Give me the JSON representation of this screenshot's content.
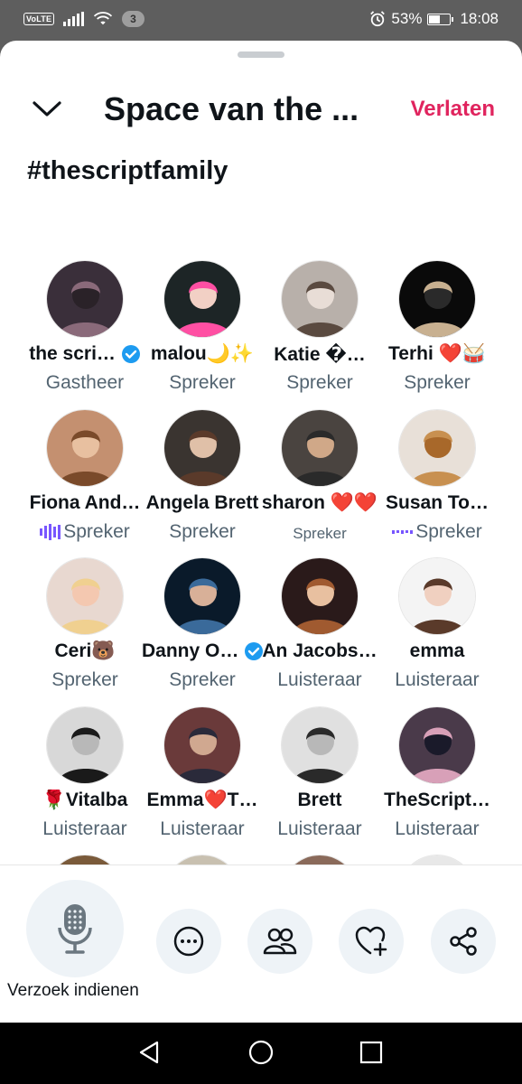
{
  "status_bar": {
    "volte": "VoLTE",
    "notification_count": "3",
    "battery_percent": "53%",
    "battery_level": 0.53,
    "time": "18:08"
  },
  "header": {
    "title": "Space van the ...",
    "leave_label": "Verlaten"
  },
  "topic": "#thescriptfamily",
  "participants": [
    {
      "name": "the scri…",
      "role": "Gastheer",
      "verified": true
    },
    {
      "name": "malou🌙✨",
      "role": "Spreker"
    },
    {
      "name": "Katie �…",
      "role": "Spreker"
    },
    {
      "name": "Terhi ❤️🥁",
      "role": "Spreker"
    },
    {
      "name": "Fiona And…",
      "role": "Spreker",
      "speaking": true
    },
    {
      "name": "Angela Brett",
      "role": "Spreker"
    },
    {
      "name": "sharon ❤️❤️",
      "role": "Spreker"
    },
    {
      "name": "Susan To…",
      "role": "Spreker",
      "speaking_small": true
    },
    {
      "name": "Ceri🐻",
      "role": "Spreker"
    },
    {
      "name": "Danny O…",
      "role": "Spreker",
      "verified": true
    },
    {
      "name": "An Jacobs…",
      "role": "Luisteraar"
    },
    {
      "name": "emma",
      "role": "Luisteraar"
    },
    {
      "name": "🌹Vitalba",
      "role": "Luisteraar"
    },
    {
      "name": "Emma❤️T…",
      "role": "Luisteraar"
    },
    {
      "name": "Brett",
      "role": "Luisteraar"
    },
    {
      "name": "TheScript…",
      "role": "Luisteraar"
    },
    {
      "name": "",
      "role": ""
    },
    {
      "name": "",
      "role": ""
    },
    {
      "name": "",
      "role": ""
    },
    {
      "name": "",
      "role": ""
    }
  ],
  "bottom_bar": {
    "request_label": "Verzoek indienen",
    "icons": [
      "microphone-icon",
      "more-icon",
      "people-icon",
      "heart-plus-icon",
      "share-icon"
    ]
  },
  "colors": {
    "accent": "#e0245e",
    "verified": "#1d9bf0",
    "speaking": "#7856ff",
    "muted_text": "#536471"
  }
}
